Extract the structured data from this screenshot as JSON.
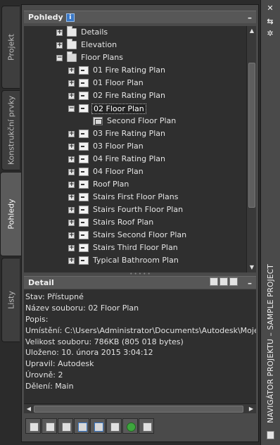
{
  "side_tabs": [
    {
      "label": "Projekt",
      "active": false
    },
    {
      "label": "Konstrukční prvky",
      "active": false
    },
    {
      "label": "Pohledy",
      "active": true
    },
    {
      "label": "Listy",
      "active": false
    }
  ],
  "views_panel": {
    "title": "Pohledy",
    "info_icon": "i",
    "minimize": "–",
    "tree": [
      {
        "label": "Details",
        "icon": "folder-icon",
        "expander": "+"
      },
      {
        "label": "Elevation",
        "icon": "folder-icon",
        "expander": "+"
      },
      {
        "label": "Floor Plans",
        "icon": "open-folder-icon",
        "expander": "−"
      },
      {
        "label": "01 Fire Rating Plan",
        "icon": "view-icon",
        "expander": "+"
      },
      {
        "label": "01 Floor Plan",
        "icon": "view-icon",
        "expander": "+"
      },
      {
        "label": "02 Fire Rating Plan",
        "icon": "view-icon",
        "expander": "+"
      },
      {
        "label": "02 Floor Plan",
        "icon": "view-icon",
        "expander": "−",
        "selected": true
      },
      {
        "label": "Second Floor Plan",
        "icon": "sheet-view-icon",
        "expander": ""
      },
      {
        "label": "03 Fire Rating Plan",
        "icon": "view-icon",
        "expander": "+"
      },
      {
        "label": "03 Floor Plan",
        "icon": "view-icon",
        "expander": "+"
      },
      {
        "label": "04 Fire Rating Plan",
        "icon": "view-icon",
        "expander": "+"
      },
      {
        "label": "04 Floor Plan",
        "icon": "view-icon",
        "expander": "+"
      },
      {
        "label": "Roof Plan",
        "icon": "view-icon",
        "expander": "+"
      },
      {
        "label": "Stairs First Floor Plans",
        "icon": "view-icon",
        "expander": "+"
      },
      {
        "label": "Stairs Fourth Floor Plan",
        "icon": "view-icon",
        "expander": "+"
      },
      {
        "label": "Stairs Roof Plan",
        "icon": "view-icon",
        "expander": "+"
      },
      {
        "label": "Stairs Second Floor Plan",
        "icon": "view-icon",
        "expander": "+"
      },
      {
        "label": "Stairs Third Floor Plan",
        "icon": "view-icon",
        "expander": "+"
      },
      {
        "label": "Typical Bathroom Plan",
        "icon": "view-icon",
        "expander": "+"
      }
    ]
  },
  "detail_panel": {
    "title": "Detail",
    "minimize": "–",
    "lines": [
      "Stav: Přístupné",
      "Název souboru: 02 Floor Plan",
      "Popis:",
      "Umístění: C:\\Users\\Administrator\\Documents\\Autodesk\\Moje",
      "Velikost souboru: 786KB (805 018 bytes)",
      "Uloženo: 10. února 2015  3:04:12",
      "Upravil: Autodesk",
      "Úrovně: 2",
      "Dělení: Main"
    ]
  },
  "toolbar": {
    "buttons": [
      "add-view-icon",
      "add-section-icon",
      "add-detail-icon",
      "regenerate-icon",
      "open-icon",
      "properties-icon",
      "refresh-icon",
      "close-icon"
    ]
  },
  "palette": {
    "title": "NAVIGÁTOR PROJEKTU – SAMPLE PROJECT",
    "close": "✕",
    "autohide": "⇆",
    "settings": "✲"
  },
  "colors": {
    "panel_bg": "#4a4a4a",
    "tree_bg": "#2f2f2f",
    "text": "#e4e4e4",
    "accent": "#3a78c6",
    "refresh_green": "#3ea63e"
  }
}
